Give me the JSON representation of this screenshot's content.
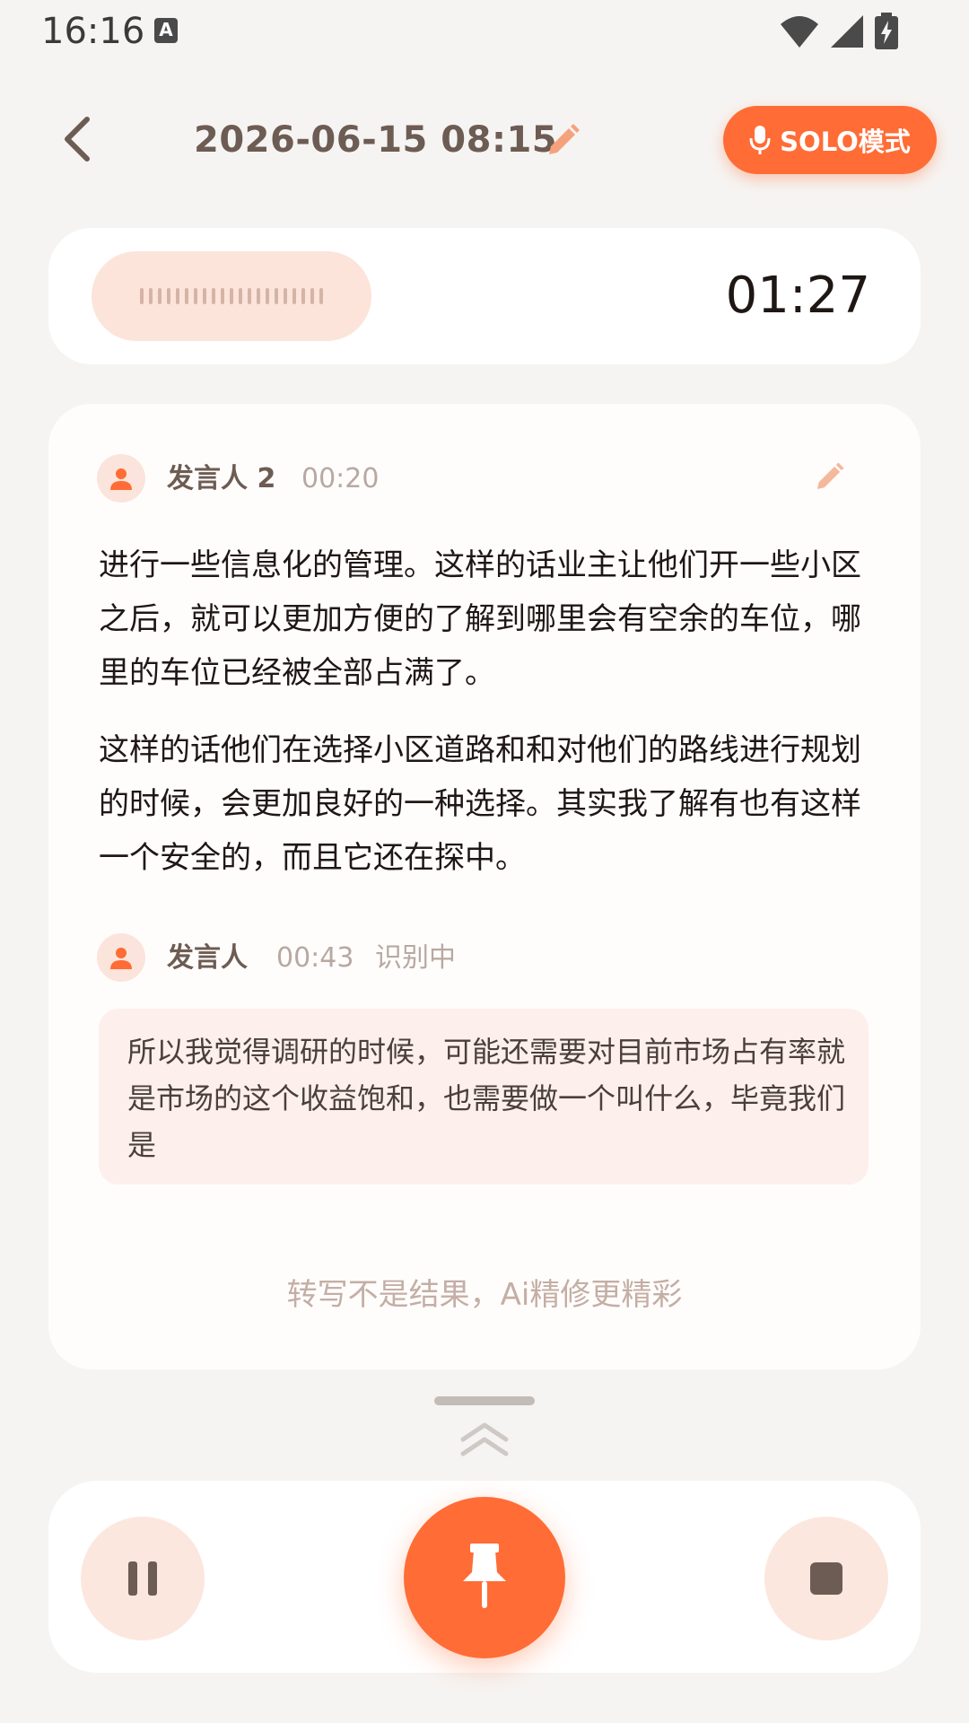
{
  "status_bar": {
    "time": "16:16",
    "notification_icon_letter": "A",
    "icons": [
      "wifi-icon",
      "signal-icon",
      "battery-charging-icon"
    ]
  },
  "header": {
    "title": "2026-06-15 08:15",
    "solo_label": "SOLO模式",
    "icons": [
      "back-arrow-icon",
      "edit-pencil-icon",
      "microphone-icon"
    ]
  },
  "recording": {
    "timer": "01:27"
  },
  "transcript": {
    "segments": [
      {
        "speaker": "发言人 2",
        "time": "00:20",
        "paragraphs": [
          "进行一些信息化的管理。这样的话业主让他们开一些小区之后，就可以更加方便的了解到哪里会有空余的车位，哪里的车位已经被全部占满了。",
          "这样的话他们在选择小区道路和和对他们的路线进行规划的时候，会更加良好的一种选择。其实我了解有也有这样一个安全的，而且它还在探中。"
        ]
      },
      {
        "speaker": "发言人",
        "time": "00:43",
        "status": "识别中",
        "live_text": "所以我觉得调研的时候，可能还需要对目前市场占有率就是市场的这个收益饱和，也需要做一个叫什么，毕竟我们是"
      }
    ],
    "hint": "转写不是结果，Ai精修更精彩"
  },
  "controls": {
    "icons": [
      "pause-icon",
      "pin-icon",
      "stop-icon"
    ]
  },
  "colors": {
    "accent": "#ff6c35",
    "accent_light": "#fce7de",
    "background": "#f6f4f2"
  }
}
